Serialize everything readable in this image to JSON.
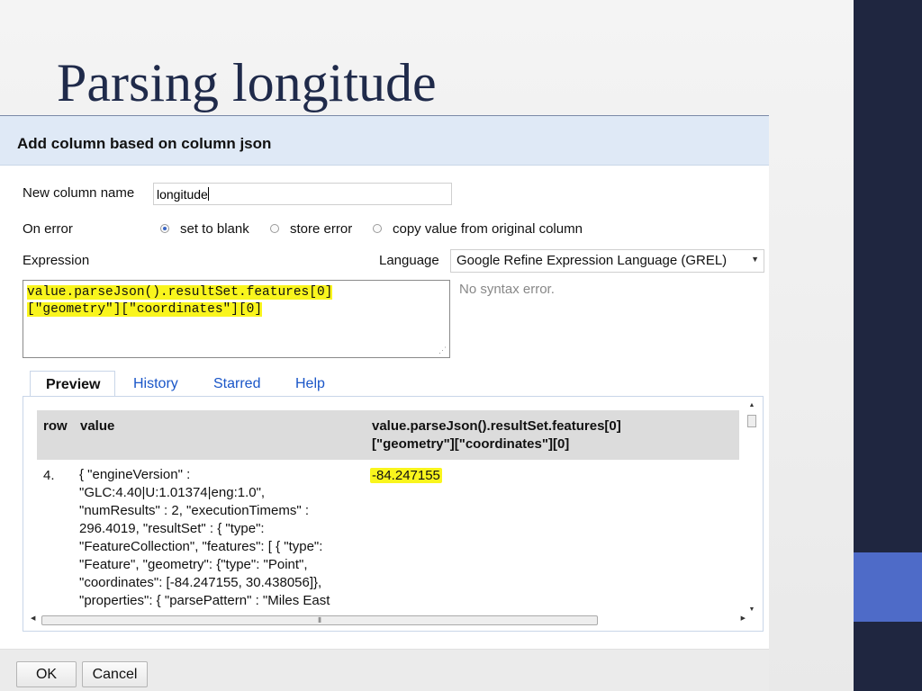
{
  "slide": {
    "title": "Parsing longitude"
  },
  "dialog": {
    "title": "Add column based on column json",
    "new_column_label": "New column name",
    "new_column_value": "longitude",
    "on_error_label": "On error",
    "on_error_options": [
      "set to blank",
      "store error",
      "copy value from original column"
    ],
    "on_error_selected": "set to blank",
    "expression_label": "Expression",
    "language_label": "Language",
    "language_value": "Google Refine Expression Language (GREL)",
    "expression_line1": "value.parseJson().resultSet.features[0]",
    "expression_line2": "[\"geometry\"][\"coordinates\"][0]",
    "syntax_status": "No syntax error.",
    "tabs": [
      "Preview",
      "History",
      "Starred",
      "Help"
    ],
    "active_tab": "Preview",
    "preview": {
      "col_row": "row",
      "col_value": "value",
      "col_result_line1": "value.parseJson().resultSet.features[0]",
      "col_result_line2": "[\"geometry\"][\"coordinates\"][0]",
      "row_number": "4.",
      "value_lines": [
        "{ \"engineVersion\" :",
        "\"GLC:4.40|U:1.01374|eng:1.0\",",
        "\"numResults\" : 2, \"executionTimems\" :",
        "296.4019, \"resultSet\" : { \"type\":",
        "\"FeatureCollection\", \"features\": [ { \"type\":",
        "\"Feature\", \"geometry\": {\"type\": \"Point\",",
        "\"coordinates\": [-84.247155, 30.438056]},",
        "\"properties\": { \"parsePattern\" : \"Miles East"
      ],
      "result_value": "-84.247155"
    },
    "buttons": {
      "ok": "OK",
      "cancel": "Cancel"
    }
  },
  "colors": {
    "header_bg": "#dfe9f6",
    "highlight": "#f9f51d",
    "link": "#1a56c8",
    "sidebar_dark": "#1f2640",
    "sidebar_accent": "#4e6bc8"
  }
}
